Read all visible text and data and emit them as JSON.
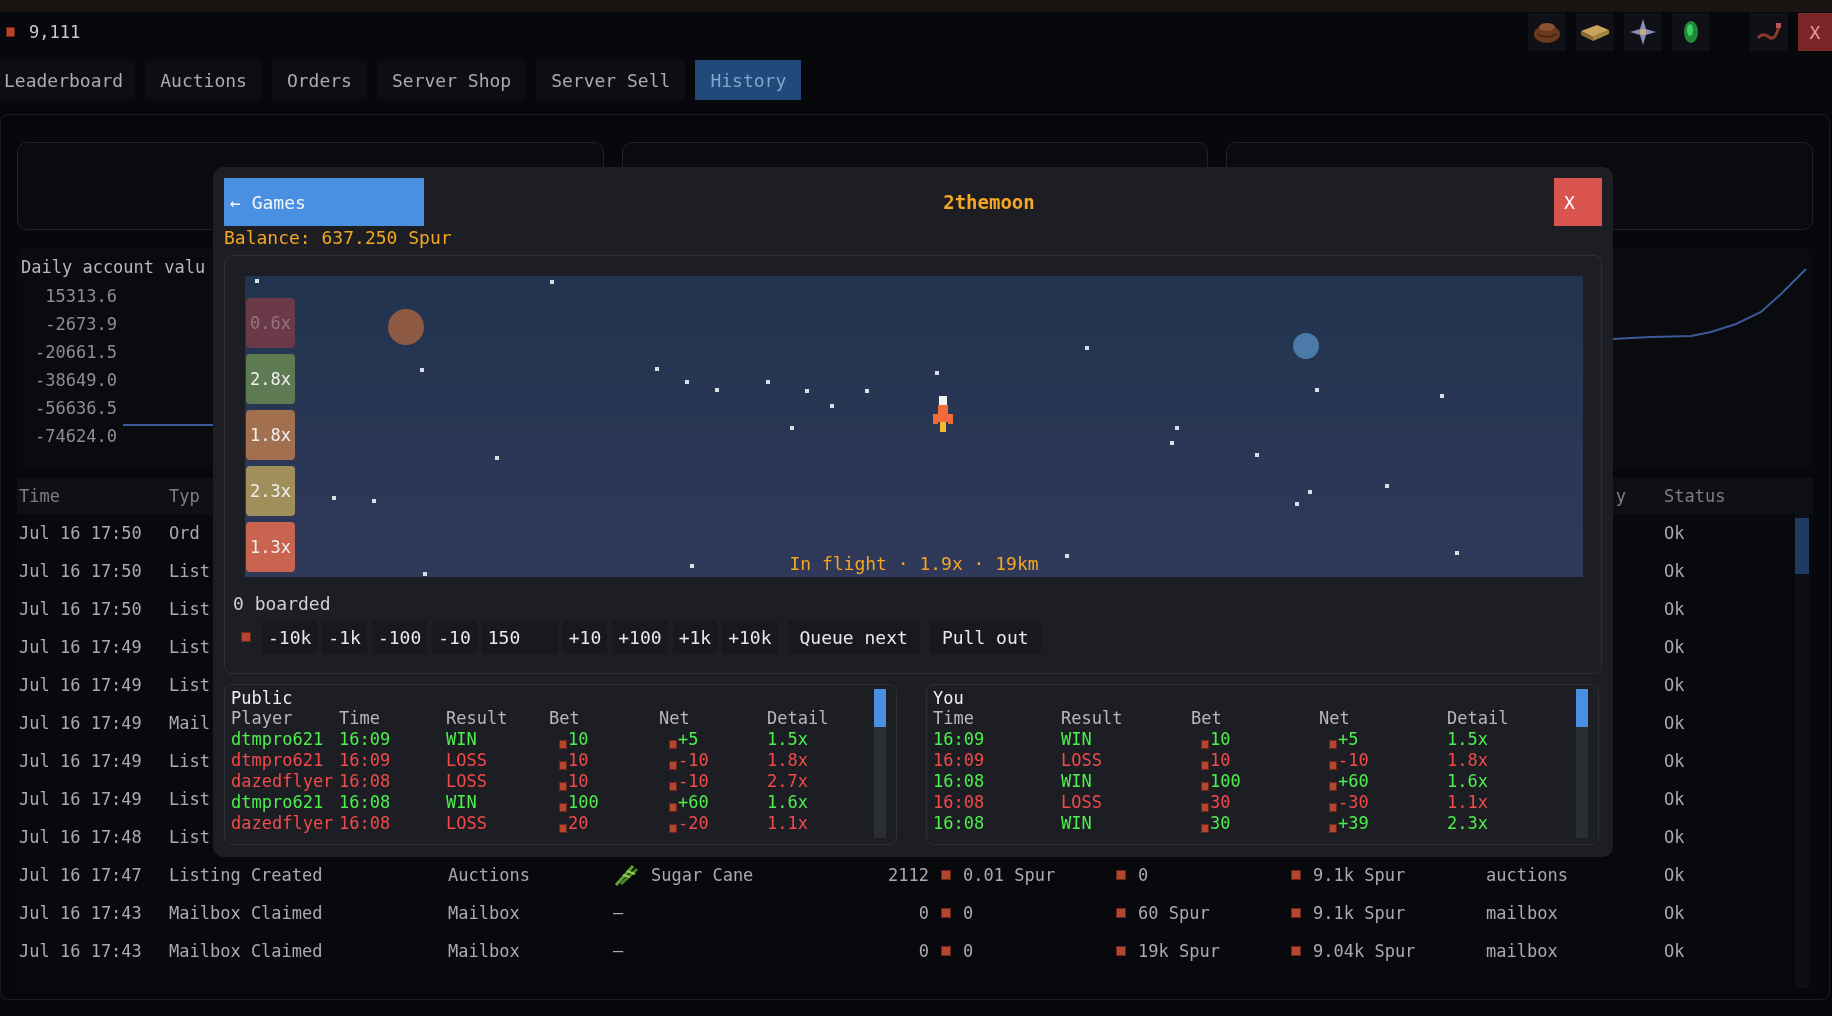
{
  "currency": {
    "amount": "9,111"
  },
  "window_close": "X",
  "tabs": [
    {
      "label": "Leaderboard",
      "selected": false
    },
    {
      "label": "Auctions",
      "selected": false
    },
    {
      "label": "Orders",
      "selected": false
    },
    {
      "label": "Server Shop",
      "selected": false
    },
    {
      "label": "Server Sell",
      "selected": false
    },
    {
      "label": "History",
      "selected": true
    }
  ],
  "chart": {
    "title": "Daily account valu",
    "y_ticks": [
      "15313.6",
      "-2673.9",
      "-20661.5",
      "-38649.0",
      "-56636.5",
      "-74624.0"
    ]
  },
  "history_table": {
    "columns": {
      "time": "Time",
      "type": "Typ",
      "column_9": "y",
      "status": "Status"
    },
    "rows": [
      {
        "time": "Jul 16 17:50",
        "type": "Ord",
        "status": "Ok"
      },
      {
        "time": "Jul 16 17:50",
        "type": "List",
        "status": "Ok"
      },
      {
        "time": "Jul 16 17:50",
        "type": "List",
        "status": "Ok"
      },
      {
        "time": "Jul 16 17:49",
        "type": "List",
        "status": "Ok"
      },
      {
        "time": "Jul 16 17:49",
        "type": "List",
        "status": "Ok"
      },
      {
        "time": "Jul 16 17:49",
        "type": "Mail",
        "status": "Ok"
      },
      {
        "time": "Jul 16 17:49",
        "type": "List",
        "status": "Ok"
      },
      {
        "time": "Jul 16 17:49",
        "type": "List",
        "status": "Ok"
      },
      {
        "time": "Jul 16 17:48",
        "type": "List",
        "status": "Ok"
      },
      {
        "time": "Jul 16 17:47",
        "type": "Listing Created",
        "source": "Auctions",
        "item": "Sugar Cane",
        "item_icon": true,
        "quantity": "2112",
        "price": "0.01 Spur",
        "column_7": "0",
        "column_8": "9.1k Spur",
        "column_9": "auctions",
        "status": "Ok"
      },
      {
        "time": "Jul 16 17:43",
        "type": "Mailbox Claimed",
        "source": "Mailbox",
        "item": "—",
        "item_icon": false,
        "quantity": "0",
        "price": "0",
        "column_7": "60 Spur",
        "column_8": "9.1k Spur",
        "column_9": "mailbox",
        "status": "Ok"
      },
      {
        "time": "Jul 16 17:43",
        "type": "Mailbox Claimed",
        "source": "Mailbox",
        "item": "—",
        "item_icon": false,
        "quantity": "0",
        "price": "0",
        "column_7": "19k Spur",
        "column_8": "9.04k Spur",
        "column_9": "mailbox",
        "status": "Ok"
      }
    ]
  },
  "modal": {
    "back_button": "← Games",
    "title": "2themoon",
    "close": "X",
    "balance": "Balance: 637.250 Spur",
    "multipliers": [
      {
        "label": "0.6x",
        "color": "#6a3a48",
        "faded": true
      },
      {
        "label": "2.8x",
        "color": "#5e7a52",
        "faded": false
      },
      {
        "label": "1.8x",
        "color": "#a3704f",
        "faded": false
      },
      {
        "label": "2.3x",
        "color": "#a08f5a",
        "faded": false
      },
      {
        "label": "1.3x",
        "color": "#c8644f",
        "faded": false
      }
    ],
    "flight_status": "In flight · 1.9x · 19km",
    "boarded": "0 boarded",
    "bet_controls": {
      "decrements": [
        "-10k",
        "-1k",
        "-100",
        "-10"
      ],
      "amount": "150",
      "increments": [
        "+10",
        "+100",
        "+1k",
        "+10k"
      ],
      "actions": [
        "Queue next",
        "Pull out"
      ]
    },
    "public": {
      "title": "Public",
      "columns": [
        "Player",
        "Time",
        "Result",
        "Bet",
        "Net",
        "Detail"
      ],
      "rows": [
        {
          "player": "dtmpro621",
          "time": "16:09",
          "result": "WIN",
          "win": true,
          "bet": "10",
          "net": "+5",
          "detail": "1.5x"
        },
        {
          "player": "dtmpro621",
          "time": "16:09",
          "result": "LOSS",
          "win": false,
          "bet": "10",
          "net": "-10",
          "detail": "1.8x"
        },
        {
          "player": "dazedflyer",
          "time": "16:08",
          "result": "LOSS",
          "win": false,
          "bet": "10",
          "net": "-10",
          "detail": "2.7x"
        },
        {
          "player": "dtmpro621",
          "time": "16:08",
          "result": "WIN",
          "win": true,
          "bet": "100",
          "net": "+60",
          "detail": "1.6x"
        },
        {
          "player": "dazedflyer",
          "time": "16:08",
          "result": "LOSS",
          "win": false,
          "bet": "20",
          "net": "-20",
          "detail": "1.1x"
        }
      ]
    },
    "you": {
      "title": "You",
      "columns": [
        "Time",
        "Result",
        "Bet",
        "Net",
        "Detail"
      ],
      "rows": [
        {
          "time": "16:09",
          "result": "WIN",
          "win": true,
          "bet": "10",
          "net": "+5",
          "detail": "1.5x"
        },
        {
          "time": "16:09",
          "result": "LOSS",
          "win": false,
          "bet": "10",
          "net": "-10",
          "detail": "1.8x"
        },
        {
          "time": "16:08",
          "result": "WIN",
          "win": true,
          "bet": "100",
          "net": "+60",
          "detail": "1.6x"
        },
        {
          "time": "16:08",
          "result": "LOSS",
          "win": false,
          "bet": "30",
          "net": "-30",
          "detail": "1.1x"
        },
        {
          "time": "16:08",
          "result": "WIN",
          "win": true,
          "bet": "30",
          "net": "+39",
          "detail": "2.3x"
        }
      ]
    }
  }
}
